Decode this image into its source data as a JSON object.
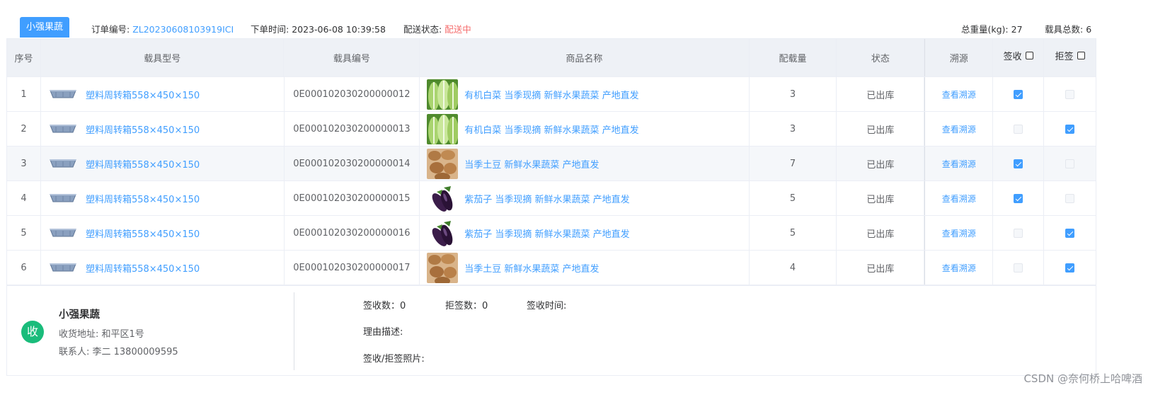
{
  "header": {
    "shop_tag": "小强果蔬",
    "order_no_label": "订单编号:",
    "order_no": "ZL20230608103919ICI",
    "order_time_label": "下单时间:",
    "order_time": "2023-06-08 10:39:58",
    "delivery_status_label": "配送状态:",
    "delivery_status": "配送中",
    "total_weight_label": "总重量(kg):",
    "total_weight": "27",
    "total_carriers_label": "载具总数:",
    "total_carriers": "6"
  },
  "table": {
    "columns": {
      "seq": "序号",
      "carrier_type": "载具型号",
      "carrier_code": "载具编号",
      "product_name": "商品名称",
      "quantity": "配载量",
      "status": "状态",
      "trace": "溯源",
      "sign": "签收",
      "reject": "拒签"
    },
    "rows": [
      {
        "seq": "1",
        "carrier_type": "塑料周转箱558×450×150",
        "carrier_code": "0E000102030200000012",
        "product": "有机白菜 当季现摘 新鲜水果蔬菜 产地直发",
        "product_icon": "cabbage-image",
        "quantity": "3",
        "status": "已出库",
        "trace": "查看溯源",
        "signed": true,
        "rejected": false
      },
      {
        "seq": "2",
        "carrier_type": "塑料周转箱558×450×150",
        "carrier_code": "0E000102030200000013",
        "product": "有机白菜 当季现摘 新鲜水果蔬菜 产地直发",
        "product_icon": "cabbage-image",
        "quantity": "3",
        "status": "已出库",
        "trace": "查看溯源",
        "signed": false,
        "rejected": true
      },
      {
        "seq": "3",
        "carrier_type": "塑料周转箱558×450×150",
        "carrier_code": "0E000102030200000014",
        "product": "当季土豆 新鲜水果蔬菜 产地直发",
        "product_icon": "potato-image",
        "quantity": "7",
        "status": "已出库",
        "trace": "查看溯源",
        "signed": true,
        "rejected": false
      },
      {
        "seq": "4",
        "carrier_type": "塑料周转箱558×450×150",
        "carrier_code": "0E000102030200000015",
        "product": "紫茄子 当季现摘 新鲜水果蔬菜 产地直发",
        "product_icon": "eggplant-image",
        "quantity": "5",
        "status": "已出库",
        "trace": "查看溯源",
        "signed": true,
        "rejected": false
      },
      {
        "seq": "5",
        "carrier_type": "塑料周转箱558×450×150",
        "carrier_code": "0E000102030200000016",
        "product": "紫茄子 当季现摘 新鲜水果蔬菜 产地直发",
        "product_icon": "eggplant-image",
        "quantity": "5",
        "status": "已出库",
        "trace": "查看溯源",
        "signed": false,
        "rejected": true
      },
      {
        "seq": "6",
        "carrier_type": "塑料周转箱558×450×150",
        "carrier_code": "0E000102030200000017",
        "product": "当季土豆 新鲜水果蔬菜 产地直发",
        "product_icon": "potato-image",
        "quantity": "4",
        "status": "已出库",
        "trace": "查看溯源",
        "signed": false,
        "rejected": true
      }
    ]
  },
  "receiver": {
    "badge": "收",
    "name": "小强果蔬",
    "address": "收货地址: 和平区1号",
    "contact": "联系人: 李二 13800009595"
  },
  "summary": {
    "sign_count": "签收数：0",
    "reject_count": "拒签数：0",
    "sign_time_label": "签收时间:",
    "reason_label": "理由描述:",
    "photo_label": "签收/拒签照片:"
  },
  "watermark": "CSDN @奈何桥上哈啤酒",
  "colors": {
    "accent": "#409eff",
    "danger": "#f56c6c",
    "badge": "#1abc7b"
  }
}
